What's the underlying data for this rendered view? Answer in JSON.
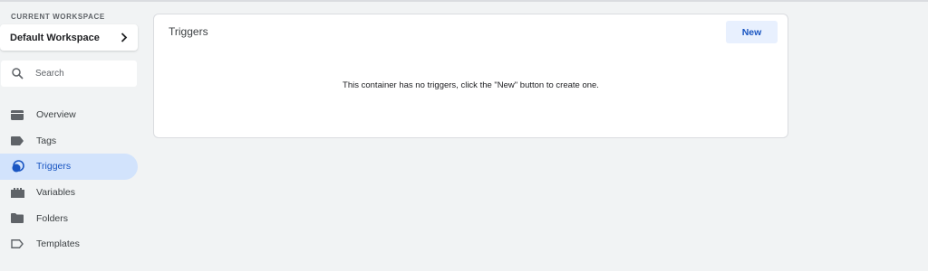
{
  "workspace": {
    "caption": "CURRENT WORKSPACE",
    "name": "Default Workspace",
    "chevron_icon": "chevron-right-icon"
  },
  "search": {
    "placeholder": "Search",
    "icon": "search-icon"
  },
  "nav": {
    "items": [
      {
        "label": "Overview",
        "icon": "overview-icon",
        "active": false
      },
      {
        "label": "Tags",
        "icon": "tag-icon",
        "active": false
      },
      {
        "label": "Triggers",
        "icon": "trigger-icon",
        "active": true
      },
      {
        "label": "Variables",
        "icon": "variables-icon",
        "active": false
      },
      {
        "label": "Folders",
        "icon": "folder-icon",
        "active": false
      },
      {
        "label": "Templates",
        "icon": "template-icon",
        "active": false
      }
    ]
  },
  "main": {
    "title": "Triggers",
    "new_button_label": "New",
    "empty_message": "This container has no triggers, click the \"New\" button to create one."
  },
  "colors": {
    "accent": "#1a56c2",
    "active_bg": "#d2e3fc",
    "button_bg": "#e8f0fe",
    "page_bg": "#f1f3f4"
  }
}
